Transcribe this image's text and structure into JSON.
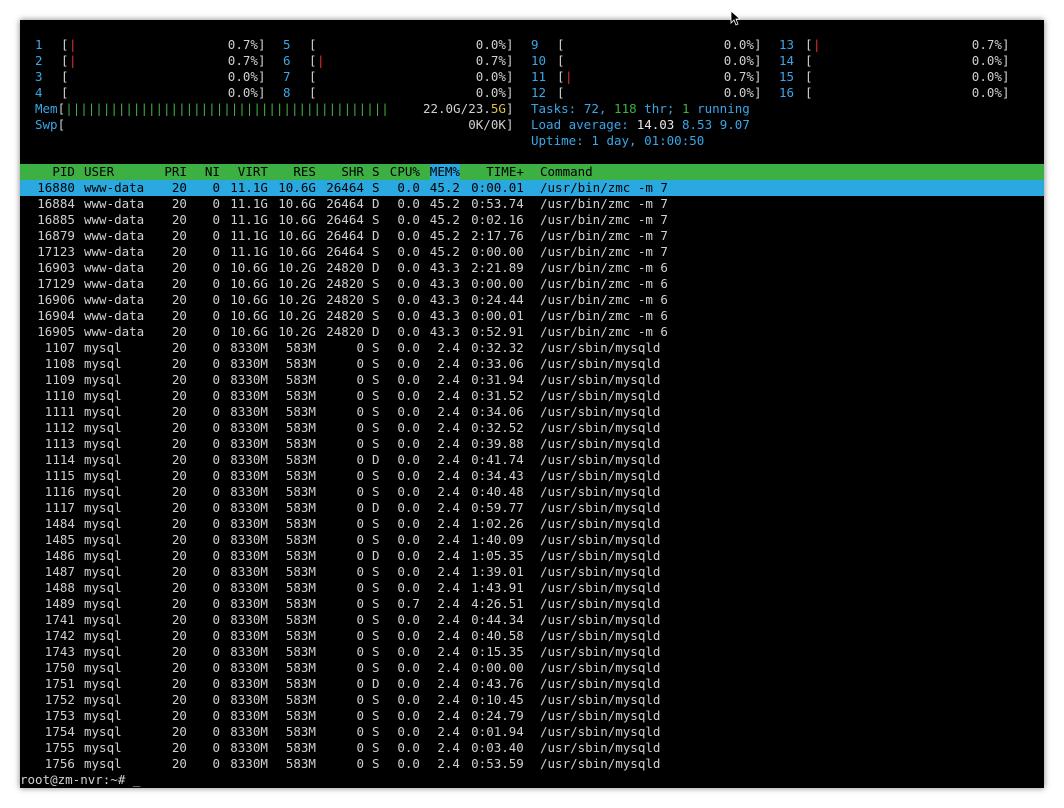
{
  "cpus": [
    {
      "id": "1",
      "bar": "|",
      "pct": "0.7%"
    },
    {
      "id": "2",
      "bar": "|",
      "pct": "0.7%"
    },
    {
      "id": "3",
      "bar": "",
      "pct": "0.0%"
    },
    {
      "id": "4",
      "bar": "",
      "pct": "0.0%"
    },
    {
      "id": "5",
      "bar": "",
      "pct": "0.0%"
    },
    {
      "id": "6",
      "bar": "|",
      "pct": "0.7%"
    },
    {
      "id": "7",
      "bar": "",
      "pct": "0.0%"
    },
    {
      "id": "8",
      "bar": "",
      "pct": "0.0%"
    },
    {
      "id": "9",
      "bar": "",
      "pct": "0.0%"
    },
    {
      "id": "10",
      "bar": "",
      "pct": "0.0%"
    },
    {
      "id": "11",
      "bar": "|",
      "pct": "0.7%"
    },
    {
      "id": "12",
      "bar": "",
      "pct": "0.0%"
    },
    {
      "id": "13",
      "bar": "|",
      "pct": "0.7%"
    },
    {
      "id": "14",
      "bar": "",
      "pct": "0.0%"
    },
    {
      "id": "15",
      "bar": "",
      "pct": "0.0%"
    },
    {
      "id": "16",
      "bar": "",
      "pct": "0.0%"
    }
  ],
  "mem": {
    "label": "Mem",
    "bar": "|||||||||||||||||||||||||||||||||||||||||||",
    "used": "22.0G",
    "total": "23.5G"
  },
  "swp": {
    "label": "Swp",
    "value": "0K/0K"
  },
  "tasks": {
    "label": "Tasks:",
    "count": "72,",
    "thr": "118",
    "thr_label": "thr;",
    "running": "1",
    "running_label": "running"
  },
  "load": {
    "label": "Load average:",
    "v1": "14.03",
    "v5": "8.53",
    "v15": "9.07"
  },
  "uptime": {
    "label": "Uptime:",
    "value": "1 day, 01:00:50"
  },
  "columns": {
    "pid": "PID",
    "user": "USER",
    "pri": "PRI",
    "ni": "NI",
    "virt": "VIRT",
    "res": "RES",
    "shr": "SHR",
    "s": "S",
    "cpu": "CPU%",
    "mem": "MEM%",
    "time": "TIME+",
    "command": "Command"
  },
  "processes": [
    {
      "pid": "16880",
      "user": "www-data",
      "pri": "20",
      "ni": "0",
      "virt": "11.1G",
      "res": "10.6G",
      "shr": "26464",
      "s": "S",
      "cpu": "0.0",
      "mem": "45.2",
      "time": "0:00.01",
      "cmd": "/usr/bin/zmc -m 7"
    },
    {
      "pid": "16884",
      "user": "www-data",
      "pri": "20",
      "ni": "0",
      "virt": "11.1G",
      "res": "10.6G",
      "shr": "26464",
      "s": "D",
      "cpu": "0.0",
      "mem": "45.2",
      "time": "0:53.74",
      "cmd": "/usr/bin/zmc -m 7"
    },
    {
      "pid": "16885",
      "user": "www-data",
      "pri": "20",
      "ni": "0",
      "virt": "11.1G",
      "res": "10.6G",
      "shr": "26464",
      "s": "S",
      "cpu": "0.0",
      "mem": "45.2",
      "time": "0:02.16",
      "cmd": "/usr/bin/zmc -m 7"
    },
    {
      "pid": "16879",
      "user": "www-data",
      "pri": "20",
      "ni": "0",
      "virt": "11.1G",
      "res": "10.6G",
      "shr": "26464",
      "s": "D",
      "cpu": "0.0",
      "mem": "45.2",
      "time": "2:17.76",
      "cmd": "/usr/bin/zmc -m 7"
    },
    {
      "pid": "17123",
      "user": "www-data",
      "pri": "20",
      "ni": "0",
      "virt": "11.1G",
      "res": "10.6G",
      "shr": "26464",
      "s": "S",
      "cpu": "0.0",
      "mem": "45.2",
      "time": "0:00.00",
      "cmd": "/usr/bin/zmc -m 7"
    },
    {
      "pid": "16903",
      "user": "www-data",
      "pri": "20",
      "ni": "0",
      "virt": "10.6G",
      "res": "10.2G",
      "shr": "24820",
      "s": "D",
      "cpu": "0.0",
      "mem": "43.3",
      "time": "2:21.89",
      "cmd": "/usr/bin/zmc -m 6"
    },
    {
      "pid": "17129",
      "user": "www-data",
      "pri": "20",
      "ni": "0",
      "virt": "10.6G",
      "res": "10.2G",
      "shr": "24820",
      "s": "S",
      "cpu": "0.0",
      "mem": "43.3",
      "time": "0:00.00",
      "cmd": "/usr/bin/zmc -m 6"
    },
    {
      "pid": "16906",
      "user": "www-data",
      "pri": "20",
      "ni": "0",
      "virt": "10.6G",
      "res": "10.2G",
      "shr": "24820",
      "s": "S",
      "cpu": "0.0",
      "mem": "43.3",
      "time": "0:24.44",
      "cmd": "/usr/bin/zmc -m 6"
    },
    {
      "pid": "16904",
      "user": "www-data",
      "pri": "20",
      "ni": "0",
      "virt": "10.6G",
      "res": "10.2G",
      "shr": "24820",
      "s": "S",
      "cpu": "0.0",
      "mem": "43.3",
      "time": "0:00.01",
      "cmd": "/usr/bin/zmc -m 6"
    },
    {
      "pid": "16905",
      "user": "www-data",
      "pri": "20",
      "ni": "0",
      "virt": "10.6G",
      "res": "10.2G",
      "shr": "24820",
      "s": "D",
      "cpu": "0.0",
      "mem": "43.3",
      "time": "0:52.91",
      "cmd": "/usr/bin/zmc -m 6"
    },
    {
      "pid": "1107",
      "user": "mysql",
      "pri": "20",
      "ni": "0",
      "virt": "8330M",
      "res": "583M",
      "shr": "0",
      "s": "S",
      "cpu": "0.0",
      "mem": "2.4",
      "time": "0:32.32",
      "cmd": "/usr/sbin/mysqld"
    },
    {
      "pid": "1108",
      "user": "mysql",
      "pri": "20",
      "ni": "0",
      "virt": "8330M",
      "res": "583M",
      "shr": "0",
      "s": "S",
      "cpu": "0.0",
      "mem": "2.4",
      "time": "0:33.06",
      "cmd": "/usr/sbin/mysqld"
    },
    {
      "pid": "1109",
      "user": "mysql",
      "pri": "20",
      "ni": "0",
      "virt": "8330M",
      "res": "583M",
      "shr": "0",
      "s": "S",
      "cpu": "0.0",
      "mem": "2.4",
      "time": "0:31.94",
      "cmd": "/usr/sbin/mysqld"
    },
    {
      "pid": "1110",
      "user": "mysql",
      "pri": "20",
      "ni": "0",
      "virt": "8330M",
      "res": "583M",
      "shr": "0",
      "s": "S",
      "cpu": "0.0",
      "mem": "2.4",
      "time": "0:31.52",
      "cmd": "/usr/sbin/mysqld"
    },
    {
      "pid": "1111",
      "user": "mysql",
      "pri": "20",
      "ni": "0",
      "virt": "8330M",
      "res": "583M",
      "shr": "0",
      "s": "S",
      "cpu": "0.0",
      "mem": "2.4",
      "time": "0:34.06",
      "cmd": "/usr/sbin/mysqld"
    },
    {
      "pid": "1112",
      "user": "mysql",
      "pri": "20",
      "ni": "0",
      "virt": "8330M",
      "res": "583M",
      "shr": "0",
      "s": "S",
      "cpu": "0.0",
      "mem": "2.4",
      "time": "0:32.52",
      "cmd": "/usr/sbin/mysqld"
    },
    {
      "pid": "1113",
      "user": "mysql",
      "pri": "20",
      "ni": "0",
      "virt": "8330M",
      "res": "583M",
      "shr": "0",
      "s": "S",
      "cpu": "0.0",
      "mem": "2.4",
      "time": "0:39.88",
      "cmd": "/usr/sbin/mysqld"
    },
    {
      "pid": "1114",
      "user": "mysql",
      "pri": "20",
      "ni": "0",
      "virt": "8330M",
      "res": "583M",
      "shr": "0",
      "s": "D",
      "cpu": "0.0",
      "mem": "2.4",
      "time": "0:41.74",
      "cmd": "/usr/sbin/mysqld"
    },
    {
      "pid": "1115",
      "user": "mysql",
      "pri": "20",
      "ni": "0",
      "virt": "8330M",
      "res": "583M",
      "shr": "0",
      "s": "S",
      "cpu": "0.0",
      "mem": "2.4",
      "time": "0:34.43",
      "cmd": "/usr/sbin/mysqld"
    },
    {
      "pid": "1116",
      "user": "mysql",
      "pri": "20",
      "ni": "0",
      "virt": "8330M",
      "res": "583M",
      "shr": "0",
      "s": "S",
      "cpu": "0.0",
      "mem": "2.4",
      "time": "0:40.48",
      "cmd": "/usr/sbin/mysqld"
    },
    {
      "pid": "1117",
      "user": "mysql",
      "pri": "20",
      "ni": "0",
      "virt": "8330M",
      "res": "583M",
      "shr": "0",
      "s": "D",
      "cpu": "0.0",
      "mem": "2.4",
      "time": "0:59.77",
      "cmd": "/usr/sbin/mysqld"
    },
    {
      "pid": "1484",
      "user": "mysql",
      "pri": "20",
      "ni": "0",
      "virt": "8330M",
      "res": "583M",
      "shr": "0",
      "s": "S",
      "cpu": "0.0",
      "mem": "2.4",
      "time": "1:02.26",
      "cmd": "/usr/sbin/mysqld"
    },
    {
      "pid": "1485",
      "user": "mysql",
      "pri": "20",
      "ni": "0",
      "virt": "8330M",
      "res": "583M",
      "shr": "0",
      "s": "S",
      "cpu": "0.0",
      "mem": "2.4",
      "time": "1:40.09",
      "cmd": "/usr/sbin/mysqld"
    },
    {
      "pid": "1486",
      "user": "mysql",
      "pri": "20",
      "ni": "0",
      "virt": "8330M",
      "res": "583M",
      "shr": "0",
      "s": "D",
      "cpu": "0.0",
      "mem": "2.4",
      "time": "1:05.35",
      "cmd": "/usr/sbin/mysqld"
    },
    {
      "pid": "1487",
      "user": "mysql",
      "pri": "20",
      "ni": "0",
      "virt": "8330M",
      "res": "583M",
      "shr": "0",
      "s": "S",
      "cpu": "0.0",
      "mem": "2.4",
      "time": "1:39.01",
      "cmd": "/usr/sbin/mysqld"
    },
    {
      "pid": "1488",
      "user": "mysql",
      "pri": "20",
      "ni": "0",
      "virt": "8330M",
      "res": "583M",
      "shr": "0",
      "s": "S",
      "cpu": "0.0",
      "mem": "2.4",
      "time": "1:43.91",
      "cmd": "/usr/sbin/mysqld"
    },
    {
      "pid": "1489",
      "user": "mysql",
      "pri": "20",
      "ni": "0",
      "virt": "8330M",
      "res": "583M",
      "shr": "0",
      "s": "S",
      "cpu": "0.7",
      "mem": "2.4",
      "time": "4:26.51",
      "cmd": "/usr/sbin/mysqld"
    },
    {
      "pid": "1741",
      "user": "mysql",
      "pri": "20",
      "ni": "0",
      "virt": "8330M",
      "res": "583M",
      "shr": "0",
      "s": "S",
      "cpu": "0.0",
      "mem": "2.4",
      "time": "0:44.34",
      "cmd": "/usr/sbin/mysqld"
    },
    {
      "pid": "1742",
      "user": "mysql",
      "pri": "20",
      "ni": "0",
      "virt": "8330M",
      "res": "583M",
      "shr": "0",
      "s": "S",
      "cpu": "0.0",
      "mem": "2.4",
      "time": "0:40.58",
      "cmd": "/usr/sbin/mysqld"
    },
    {
      "pid": "1743",
      "user": "mysql",
      "pri": "20",
      "ni": "0",
      "virt": "8330M",
      "res": "583M",
      "shr": "0",
      "s": "S",
      "cpu": "0.0",
      "mem": "2.4",
      "time": "0:15.35",
      "cmd": "/usr/sbin/mysqld"
    },
    {
      "pid": "1750",
      "user": "mysql",
      "pri": "20",
      "ni": "0",
      "virt": "8330M",
      "res": "583M",
      "shr": "0",
      "s": "S",
      "cpu": "0.0",
      "mem": "2.4",
      "time": "0:00.00",
      "cmd": "/usr/sbin/mysqld"
    },
    {
      "pid": "1751",
      "user": "mysql",
      "pri": "20",
      "ni": "0",
      "virt": "8330M",
      "res": "583M",
      "shr": "0",
      "s": "D",
      "cpu": "0.0",
      "mem": "2.4",
      "time": "0:43.76",
      "cmd": "/usr/sbin/mysqld"
    },
    {
      "pid": "1752",
      "user": "mysql",
      "pri": "20",
      "ni": "0",
      "virt": "8330M",
      "res": "583M",
      "shr": "0",
      "s": "S",
      "cpu": "0.0",
      "mem": "2.4",
      "time": "0:10.45",
      "cmd": "/usr/sbin/mysqld"
    },
    {
      "pid": "1753",
      "user": "mysql",
      "pri": "20",
      "ni": "0",
      "virt": "8330M",
      "res": "583M",
      "shr": "0",
      "s": "S",
      "cpu": "0.0",
      "mem": "2.4",
      "time": "0:24.79",
      "cmd": "/usr/sbin/mysqld"
    },
    {
      "pid": "1754",
      "user": "mysql",
      "pri": "20",
      "ni": "0",
      "virt": "8330M",
      "res": "583M",
      "shr": "0",
      "s": "S",
      "cpu": "0.0",
      "mem": "2.4",
      "time": "0:01.94",
      "cmd": "/usr/sbin/mysqld"
    },
    {
      "pid": "1755",
      "user": "mysql",
      "pri": "20",
      "ni": "0",
      "virt": "8330M",
      "res": "583M",
      "shr": "0",
      "s": "S",
      "cpu": "0.0",
      "mem": "2.4",
      "time": "0:03.40",
      "cmd": "/usr/sbin/mysqld"
    },
    {
      "pid": "1756",
      "user": "mysql",
      "pri": "20",
      "ni": "0",
      "virt": "8330M",
      "res": "583M",
      "shr": "0",
      "s": "S",
      "cpu": "0.0",
      "mem": "2.4",
      "time": "0:53.59",
      "cmd": "/usr/sbin/mysqld"
    }
  ],
  "prompt": "root@zm-nvr:~# _",
  "colors": {
    "green": "#40b040",
    "cyan": "#3aa6e8",
    "red": "#e03030",
    "header_bg": "#3cb043",
    "selected_bg": "#2aa8e0"
  }
}
